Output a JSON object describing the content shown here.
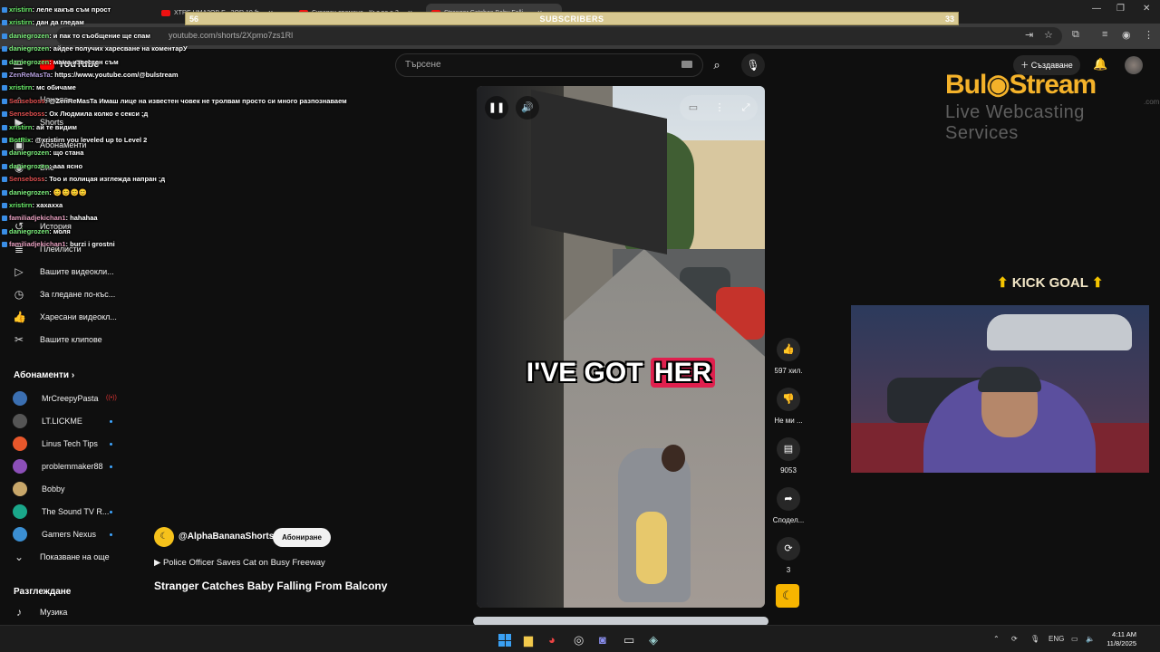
{
  "browser": {
    "tabs": [
      {
        "label": "XTRE HMA3OB E...3OR 10 'h"
      },
      {
        "label": "Скрепен тромене - Кът ве о 3"
      },
      {
        "label": "Stranger Catches Baby Falli..."
      }
    ],
    "url": "youtube.com/shorts/2Xpmo7zs1Rl"
  },
  "overlay": {
    "sub_left": "56",
    "sub_label": "SUBSCRIBERS",
    "sub_right": "33"
  },
  "chat": [
    {
      "user": "xristirn",
      "msg": ": леле какъв съм прост",
      "color": "#6cf06c"
    },
    {
      "user": "xristirn",
      "msg": ": дан да гледам",
      "color": "#6cf06c"
    },
    {
      "user": "daniegrozen",
      "msg": ": и пак то съобщение ще спам",
      "color": "#7df07d"
    },
    {
      "user": "daniegrozen",
      "msg": ": айдее получих харесване на коментарУ",
      "color": "#7df07d"
    },
    {
      "user": "daniegrozen",
      "msg": ": мама известен съм",
      "color": "#7df07d"
    },
    {
      "user": "ZenReMasTa",
      "msg": ": https://www.youtube.com/@bulstream",
      "color": "#b39ddb"
    },
    {
      "user": "xristirn",
      "msg": ": мс обичаме",
      "color": "#6cf06c"
    },
    {
      "user": "Senseboss",
      "msg": ": @ZenReMasTa Имаш лице на известен човек не тролвам просто си много разпознаваем",
      "color": "#e05050"
    },
    {
      "user": "Senseboss",
      "msg": ": Ох Людмила колко е секси ;д",
      "color": "#e05050"
    },
    {
      "user": "xristirn",
      "msg": ": ай те видим",
      "color": "#6cf06c"
    },
    {
      "user": "BotRix",
      "msg": ": @xristirn you leveled up to Level 2",
      "color": "#6cf06c"
    },
    {
      "user": "daniegrozen",
      "msg": ": що стана",
      "color": "#7df07d"
    },
    {
      "user": "daniegrozen",
      "msg": ": ааа ясно",
      "color": "#7df07d"
    },
    {
      "user": "Senseboss",
      "msg": ": Тоо и полицая изглежда напран ;д",
      "color": "#e05050"
    },
    {
      "user": "daniegrozen",
      "msg": ": 😊😊😊😊",
      "color": "#7df07d"
    },
    {
      "user": "xristirn",
      "msg": ": хахахха",
      "color": "#6cf06c"
    },
    {
      "user": "familiadjekichan1",
      "msg": ": hahahaa",
      "color": "#e8a0c0"
    },
    {
      "user": "daniegrozen",
      "msg": ": моля",
      "color": "#7df07d"
    },
    {
      "user": "familiadjekichan1",
      "msg": ": burzi i grostni",
      "color": "#e8a0c0"
    }
  ],
  "youtube": {
    "logo": "YouTube",
    "search_placeholder": "Търсене",
    "create_label": "Създаване",
    "sidebar": {
      "items": [
        {
          "label": "Начало",
          "icon": "home-icon"
        },
        {
          "label": "Shorts",
          "icon": "shorts-icon"
        },
        {
          "label": "Абонаменти",
          "icon": "subscriptions-icon"
        },
        {
          "label": "Вие",
          "icon": "you-icon"
        },
        {
          "label": "История",
          "icon": "history-icon"
        },
        {
          "label": "Плейлисти",
          "icon": "playlist-icon"
        },
        {
          "label": "Вашите видеоклипове",
          "icon": "video-icon"
        },
        {
          "label": "За гледане по-късно",
          "icon": "clock-icon"
        },
        {
          "label": "Харесани видеоклипове",
          "icon": "thumb-up-icon"
        },
        {
          "label": "Вашите клипове",
          "icon": "scissors-icon"
        }
      ],
      "items_short": [
        "Вашите видеокли...",
        "За гледане по-къс...",
        "Харесани видеокл...",
        "Вашите клипове"
      ],
      "subs_header": "Абонаменти",
      "subs": [
        {
          "name": "MrCreepyPasta",
          "color": "#3b6fb1",
          "live": true
        },
        {
          "name": "LT.LICKME",
          "color": "#555"
        },
        {
          "name": "Linus Tech Tips",
          "color": "#e8572b"
        },
        {
          "name": "problemmaker88",
          "color": "#8c4fb8"
        },
        {
          "name": "Bobby",
          "color": "#c8a76a"
        },
        {
          "name": "The Sound TV R...",
          "color": "#1aa78a"
        },
        {
          "name": "Gamers Nexus",
          "color": "#3b8fd3"
        }
      ],
      "show_more": "Показване на още",
      "explore_header": "Разглеждане",
      "music": "Музика"
    },
    "short": {
      "caption_a": "I'VE GOT",
      "caption_b": "HER",
      "channel": "@AlphaBananaShorts",
      "subscribe": "Абониране",
      "next_title": "Police Officer Saves Cat on Busy Freeway",
      "title": "Stranger Catches Baby Falling From Balcony",
      "likes": "597 хил.",
      "dislike": "Не ми ...",
      "comments": "9053",
      "share": "Сподел...",
      "remix": "3"
    }
  },
  "stream": {
    "brand_a": "Bul",
    "brand_b": "Stream",
    "brand_sub": "Live Webcasting Services",
    "brand_dotcom": ".com",
    "kick": "KICK GOAL"
  },
  "taskbar": {
    "lang": "ENG",
    "time": "4:11 AM",
    "date": "11/8/2025"
  }
}
